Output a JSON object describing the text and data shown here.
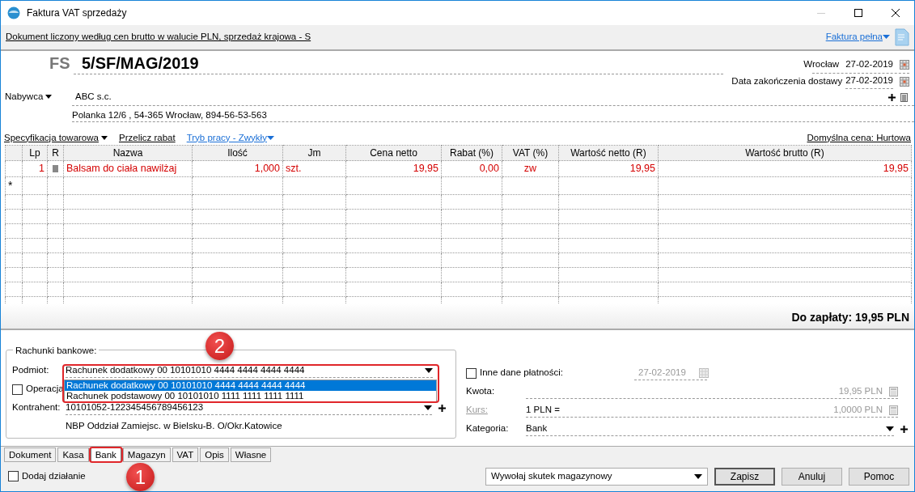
{
  "window": {
    "title": "Faktura VAT sprzedaży"
  },
  "info_bar": {
    "text": "Dokument liczony według cen brutto w walucie PLN, sprzedaż krajowa - S",
    "document_type": "Faktura pełna"
  },
  "header": {
    "prefix": "FS",
    "number": "5/SF/MAG/2019",
    "place": "Wrocław",
    "issue_date": "27-02-2019",
    "delivery_label": "Data zakończenia dostawy",
    "delivery_date": "27-02-2019"
  },
  "buyer": {
    "label": "Nabywca",
    "name": "ABC s.c.",
    "address": "Polanka  12/6 , 54-365 Wrocław, 894-56-53-563"
  },
  "toolbar": [
    {
      "label": "Specyfikacja towarowa",
      "kind": "menu"
    },
    {
      "label": "Przelicz rabat",
      "kind": "link"
    },
    {
      "label": "Tryb pracy - Zwykły",
      "kind": "mode"
    }
  ],
  "default_price": "Domyślna cena: Hurtowa",
  "table": {
    "columns": [
      "Lp",
      "R",
      "Nazwa",
      "Ilość",
      "Jm",
      "Cena netto",
      "Rabat (%)",
      "VAT (%)",
      "Wartość netto (R)",
      "Wartość brutto (R)"
    ],
    "rows": [
      {
        "lp": "1",
        "name": "Balsam do ciała nawilżaj",
        "quantity": "1,000",
        "unit": "szt.",
        "net_price": "19,95",
        "discount": "0,00",
        "vat": "zw",
        "net_value": "19,95",
        "gross_value": "19,95"
      }
    ],
    "new_row_marker": "*"
  },
  "total": "Do zapłaty: 19,95 PLN",
  "bank": {
    "legend": "Rachunki bankowe:",
    "subject_label": "Podmiot:",
    "subject_value": "Rachunek dodatkowy 00 10101010 4444 4444 4444 4444",
    "options": [
      {
        "label": "Rachunek dodatkowy 00 10101010 4444 4444 4444 4444",
        "selected": true
      },
      {
        "label": "Rachunek podstawowy 00 10101010 1111 1111 1111 1111",
        "selected": false
      }
    ],
    "operation": {
      "label": "Operacja",
      "checked": false
    },
    "contractor_label": "Kontrahent:",
    "contractor_value": "10101052-122345456789456123",
    "bank_name": "NBP Oddział Zamiejsc. w Bielsku-B.  O/Okr.Katowice"
  },
  "payment": {
    "other": {
      "label": "Inne dane płatności:",
      "checked": false
    },
    "date": "27-02-2019",
    "amount_label": "Kwota:",
    "amount": "19,95 PLN",
    "rate_label": "Kurs:",
    "rate_left": "1 PLN =",
    "rate_right": "1,0000 PLN",
    "category_label": "Kategoria:",
    "category": "Bank"
  },
  "tabs": [
    {
      "label": "Dokument",
      "selected": false
    },
    {
      "label": "Kasa",
      "selected": false
    },
    {
      "label": "Bank",
      "selected": true
    },
    {
      "label": "Magazyn",
      "selected": false
    },
    {
      "label": "VAT",
      "selected": false
    },
    {
      "label": "Opis",
      "selected": false
    },
    {
      "label": "Własne",
      "selected": false
    }
  ],
  "footer": {
    "add_action": {
      "label": "Dodaj działanie",
      "checked": false
    },
    "effect": "Wywołaj skutek magazynowy",
    "buttons": [
      {
        "label": "Zapisz",
        "default": true
      },
      {
        "label": "Anuluj",
        "default": false
      },
      {
        "label": "Pomoc",
        "default": false
      }
    ]
  },
  "callouts": [
    "2",
    "1"
  ]
}
